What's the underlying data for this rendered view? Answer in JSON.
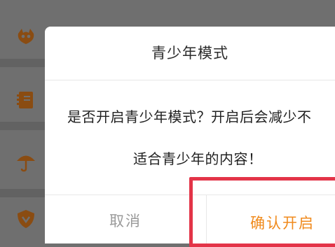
{
  "dialog": {
    "title": "青少年模式",
    "message_line1": "是否开启青少年模式？开启后会减少不",
    "message_line2": "适合青少年的内容！",
    "cancel_label": "取消",
    "confirm_label": "确认开启"
  },
  "background_icons": [
    "monster-icon",
    "notebook-icon",
    "umbrella-icon",
    "shield-icon"
  ],
  "colors": {
    "accent": "#f08a1c",
    "highlight_border": "#e33448",
    "overlay": "#6f6f6f",
    "icon_dimmed": "#8a4c12"
  }
}
